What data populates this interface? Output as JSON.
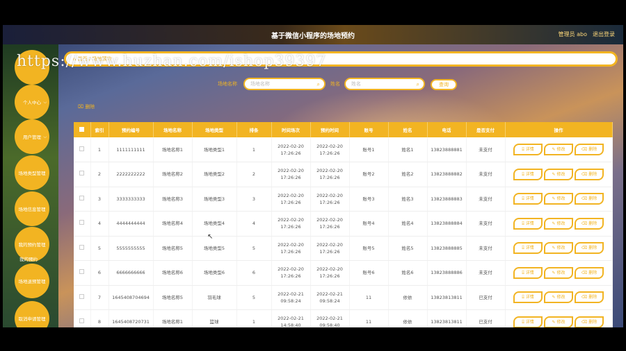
{
  "header": {
    "title": "基于微信小程序的场地预约",
    "user": "管理员 abo",
    "logout": "退出登录"
  },
  "watermark": "https://www.huzhan.com/ishop39397",
  "breadcrumb": {
    "home": "⌂ 首页 / 场地预约"
  },
  "sidebar": {
    "items": [
      {
        "label": "",
        "has_chevron": false
      },
      {
        "label": "个人中心",
        "has_chevron": true
      },
      {
        "label": "用户管理",
        "has_chevron": true
      },
      {
        "label": "场地类型管理",
        "has_chevron": false
      },
      {
        "label": "场地信息管理",
        "has_chevron": false
      },
      {
        "label": "我的预约管理",
        "has_chevron": false
      },
      {
        "label": "场地退预管理",
        "has_chevron": false
      },
      {
        "label": "取消申请管理",
        "has_chevron": false
      }
    ],
    "sub_label": "我的预约"
  },
  "search": {
    "field1_label": "场地名称",
    "field1_placeholder": "场地名称",
    "field2_label": "姓名",
    "field2_placeholder": "姓名",
    "button": "查询"
  },
  "toolbar": {
    "delete_label": "⌧ 删除"
  },
  "table": {
    "columns": [
      "",
      "索引",
      "预约编号",
      "场地名称",
      "场地类型",
      "排条",
      "时间场次",
      "预约时间",
      "账号",
      "姓名",
      "电话",
      "是否支付",
      "操作"
    ],
    "rows": [
      {
        "idx": "1",
        "no": "1111111111",
        "venue": "场地名称1",
        "type": "场地类型1",
        "num": "1",
        "slot": "2022-02-20 17:26:26",
        "time": "2022-02-20 17:26:26",
        "account": "账号1",
        "name": "姓名1",
        "phone": "13823888881",
        "paid": "未支付"
      },
      {
        "idx": "2",
        "no": "2222222222",
        "venue": "场地名称2",
        "type": "场地类型2",
        "num": "2",
        "slot": "2022-02-20 17:26:26",
        "time": "2022-02-20 17:26:26",
        "account": "账号2",
        "name": "姓名2",
        "phone": "13823888882",
        "paid": "未支付"
      },
      {
        "idx": "3",
        "no": "3333333333",
        "venue": "场地名称3",
        "type": "场地类型3",
        "num": "3",
        "slot": "2022-02-20 17:26:26",
        "time": "2022-02-20 17:26:26",
        "account": "账号3",
        "name": "姓名3",
        "phone": "13823888883",
        "paid": "未支付"
      },
      {
        "idx": "4",
        "no": "4444444444",
        "venue": "场地名称4",
        "type": "场地类型4",
        "num": "4",
        "slot": "2022-02-20 17:26:26",
        "time": "2022-02-20 17:26:26",
        "account": "账号4",
        "name": "姓名4",
        "phone": "13823888884",
        "paid": "未支付"
      },
      {
        "idx": "5",
        "no": "5555555555",
        "venue": "场地名称5",
        "type": "场地类型5",
        "num": "5",
        "slot": "2022-02-20 17:26:26",
        "time": "2022-02-20 17:26:26",
        "account": "账号5",
        "name": "姓名5",
        "phone": "13823888885",
        "paid": "未支付"
      },
      {
        "idx": "6",
        "no": "6666666666",
        "venue": "场地名称6",
        "type": "场地类型6",
        "num": "6",
        "slot": "2022-02-20 17:26:26",
        "time": "2022-02-20 17:26:26",
        "account": "账号6",
        "name": "姓名6",
        "phone": "13823888886",
        "paid": "未支付"
      },
      {
        "idx": "7",
        "no": "1645408704694",
        "venue": "场地名称5",
        "type": "羽毛球",
        "num": "5",
        "slot": "2022-02-21 09:58:24",
        "time": "2022-02-21 09:58:24",
        "account": "11",
        "name": "依依",
        "phone": "13823813811",
        "paid": "已支付"
      },
      {
        "idx": "8",
        "no": "1645408720731",
        "venue": "场地名称1",
        "type": "篮球",
        "num": "1",
        "slot": "2022-02-21 14:58:40",
        "time": "2022-02-21 09:58:40",
        "account": "11",
        "name": "依依",
        "phone": "13823813811",
        "paid": "已支付"
      }
    ],
    "actions": {
      "detail": "⌸ 详情",
      "edit": "✎ 修改",
      "delete": "⌫ 删除"
    }
  }
}
